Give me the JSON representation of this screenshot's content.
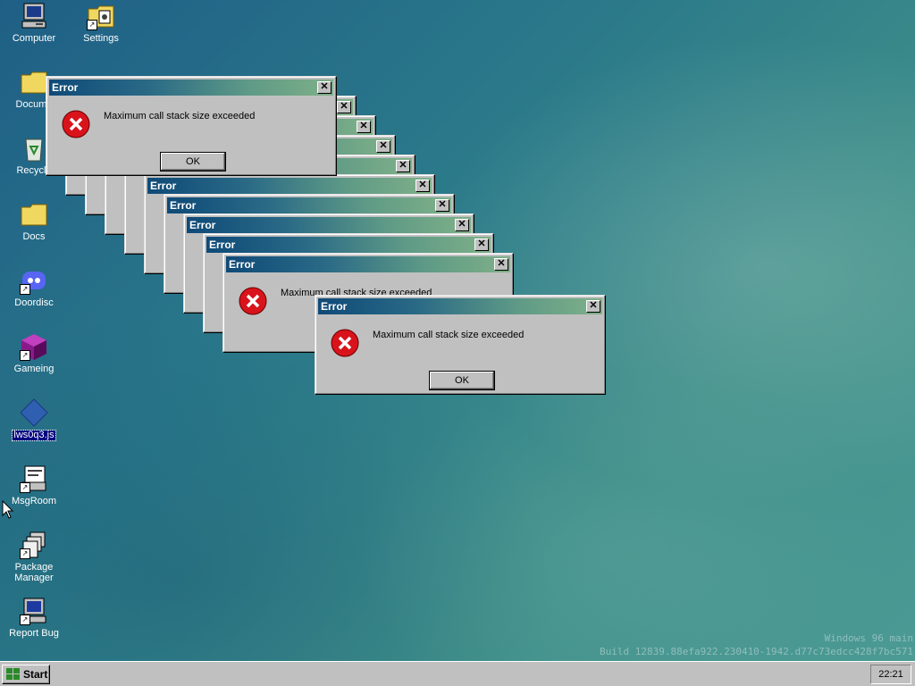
{
  "desktop": {
    "icons": [
      {
        "label": "Computer",
        "icon": "computer-icon"
      },
      {
        "label": "Settings",
        "icon": "settings-folder-icon"
      },
      {
        "label": "Docume",
        "icon": "documents-folder-icon"
      },
      {
        "label": "Recycle",
        "icon": "recycle-bin-icon"
      },
      {
        "label": "Docs",
        "icon": "folder-icon"
      },
      {
        "label": "Doordisc",
        "icon": "doordisc-icon"
      },
      {
        "label": "Gameing",
        "icon": "gameing-icon"
      },
      {
        "label": "lws0q3.js",
        "icon": "js-file-icon"
      },
      {
        "label": "MsgRoom",
        "icon": "msgroom-icon"
      },
      {
        "label": "Package",
        "label2": "Manager",
        "icon": "package-manager-icon"
      },
      {
        "label": "Report Bug",
        "icon": "report-bug-icon"
      }
    ]
  },
  "dialog": {
    "title": "Error",
    "message": "Maximum call stack size exceeded",
    "ok_label": "OK",
    "close_glyph": "✕"
  },
  "watermark": {
    "line1": "Windows 96 main",
    "line2": "Build 12839.88efa922.230410-1942.d77c73edcc428f7bc571"
  },
  "taskbar": {
    "start_label": "Start",
    "clock": "22:21"
  },
  "colors": {
    "titlebar_start": "#0f4a78",
    "titlebar_end": "#7fb088",
    "error_red": "#d9131b",
    "selection": "#000080"
  }
}
